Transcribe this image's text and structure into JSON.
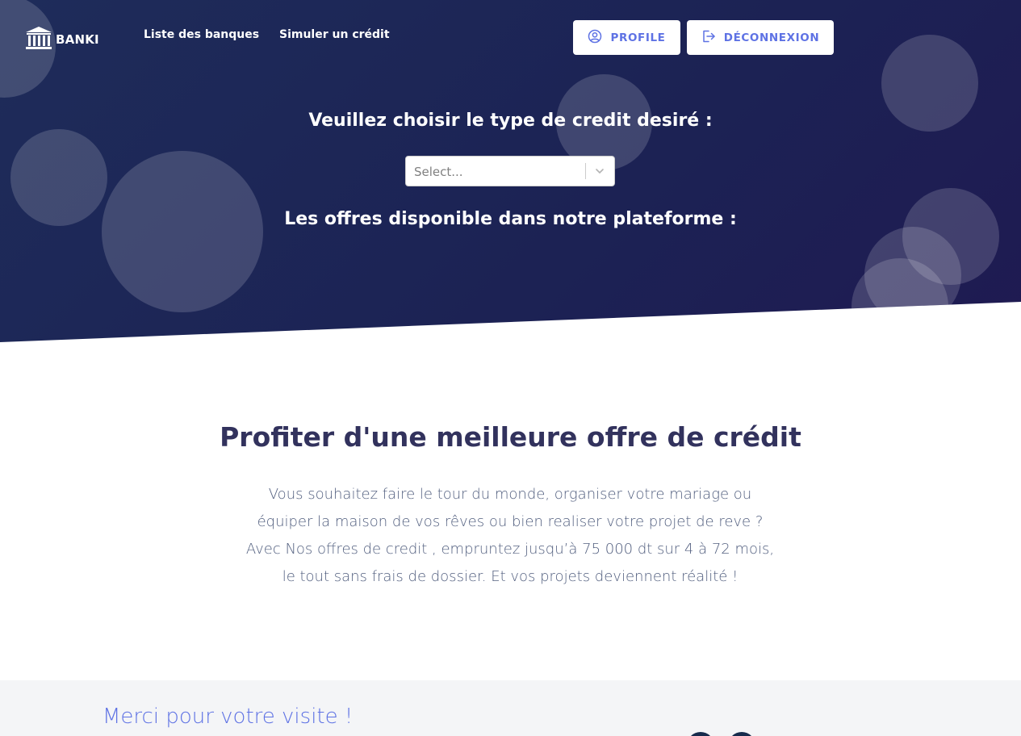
{
  "brand": {
    "name": "BANKI",
    "icon": "bank-building-icon"
  },
  "nav": {
    "links": [
      "Liste des banques",
      "Simuler un crédit"
    ],
    "profile_label": "PROFILE",
    "profile_icon": "user-circle-icon",
    "logout_label": "DÉCONNEXION",
    "logout_icon": "sign-out-icon"
  },
  "hero": {
    "credit_prompt": "Veuillez choisir le type de credit desiré :",
    "select_placeholder": "Select...",
    "select_icon": "chevron-down-icon",
    "offers_title": "Les offres disponible dans notre plateforme :"
  },
  "promo": {
    "title": "Profiter d'une meilleure offre de crédit",
    "lines": [
      "Vous souhaitez faire le tour du monde, organiser votre mariage ou",
      "équiper la maison de vos rêves ou bien realiser votre projet de reve ?",
      "Avec Nos offres de credit , empruntez jusqu’à 75 000 dt sur 4 à 72 mois,",
      "le tout sans frais de dossier. Et vos projets deviennent réalité !"
    ]
  },
  "footer": {
    "title": "Merci pour votre visite !"
  },
  "colors": {
    "hero_bg": "#1e2856",
    "accent": "#5e72e4",
    "heading": "#32325d",
    "body_text": "#525f7f",
    "footer_bg": "#f4f5f7"
  }
}
